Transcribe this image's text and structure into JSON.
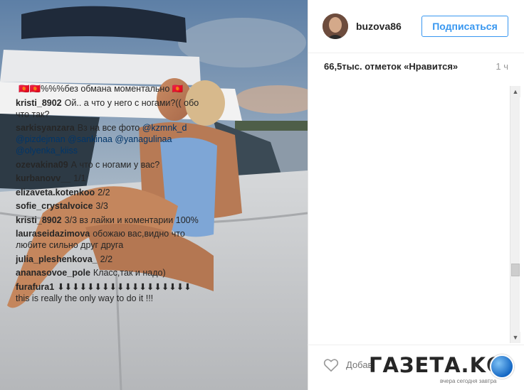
{
  "header": {
    "username": "buzova86",
    "follow_label": "Подписаться"
  },
  "meta": {
    "likes": "66,5тыс. отметок «Нравится»",
    "time": "1 ч"
  },
  "comments": [
    {
      "user": "",
      "text": "🇰🇬🇰🇬%%%без обмана моментально 🇰🇬"
    },
    {
      "user": "kristi_8902",
      "text": "Ой.. а что у него с ногами?(( обо что так?"
    },
    {
      "user": "sarkisyanzara",
      "text": "Вз на все фото",
      "mentions": "@kzmnk_d @pizdejman @sankinaa @yanagulinaa @olyenka_kiiss"
    },
    {
      "user": "ozevakina09",
      "text": "А что с ногами у вас?"
    },
    {
      "user": "kurbanovv__",
      "text": "1/1"
    },
    {
      "user": "elizaveta.kotenkoo",
      "text": "2/2"
    },
    {
      "user": "sofie_crystalvoice",
      "text": "3/3"
    },
    {
      "user": "kristi_8902",
      "text": "3/3 вз лайки и коментарии 100%"
    },
    {
      "user": "lauraseidazimova",
      "text": "обожаю вас,видно что любите сильно друг друга"
    },
    {
      "user": "julia_pleshenkova_",
      "text": "2/2"
    },
    {
      "user": "ananasovoe_pole",
      "text": "Класс,так и надо)"
    },
    {
      "user": "furafura1",
      "text": "⬇⬇⬇⬇⬇⬇⬇⬇⬇⬇⬇⬇⬇⬇⬇⬇⬇⬇ this is really the only way to do it !!!"
    }
  ],
  "add_comment": {
    "placeholder": "Добав"
  },
  "watermark": {
    "name": "ГАЗЕТА.KG",
    "tagline": "вчера сегодня завтра"
  },
  "icons": {
    "heart": "heart-icon",
    "scroll_up": "chevron-up-icon",
    "scroll_down": "chevron-down-icon"
  }
}
